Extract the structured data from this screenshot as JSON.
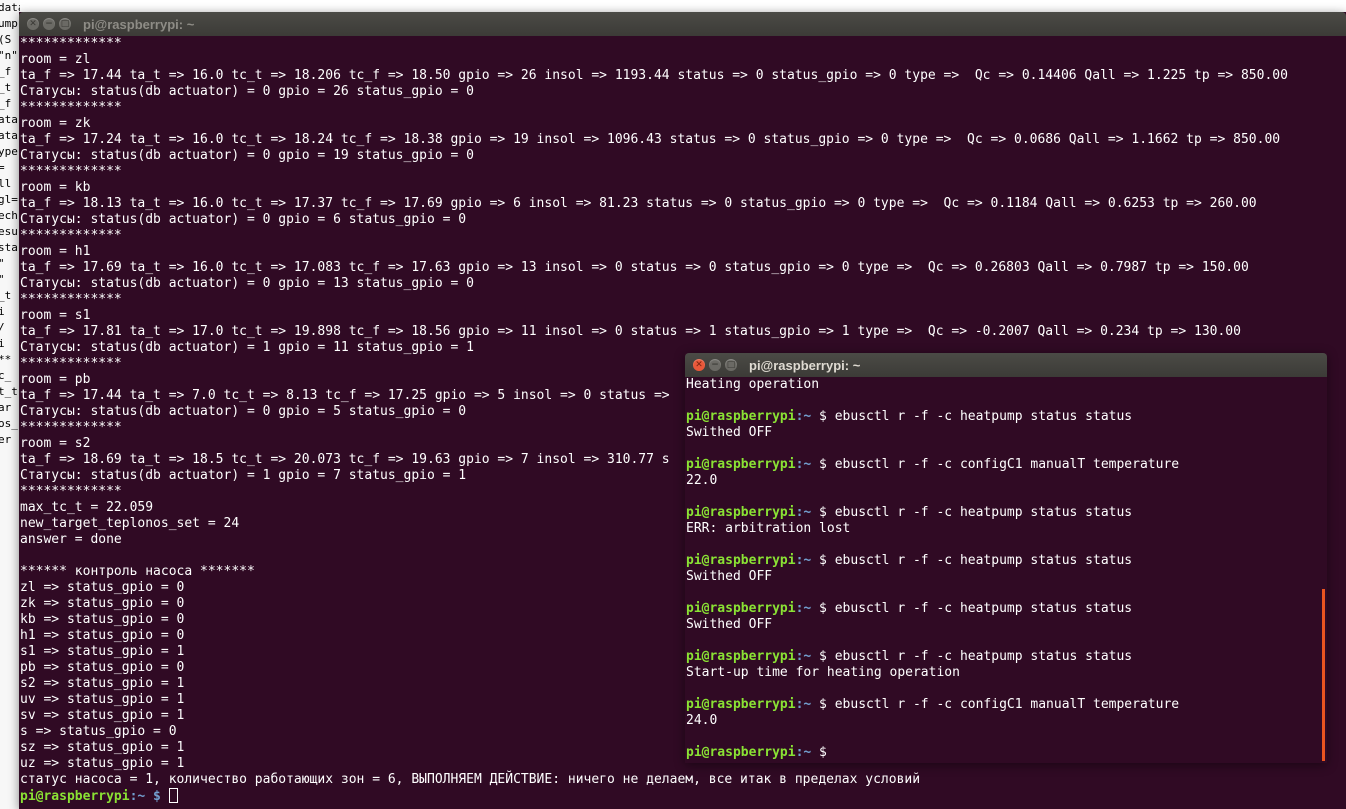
{
  "background_editor": {
    "lines": [
      "data",
      "ump",
      "(S",
      "",
      "\"n\"",
      "_f",
      "_t",
      "_f",
      "ata",
      "ata",
      "ype",
      "=",
      "ll",
      "",
      "gl=",
      "ech",
      "esu",
      "",
      "sta",
      "\"",
      "\"",
      "_t",
      "",
      "i",
      "",
      "",
      "",
      "",
      "",
      "",
      "",
      "/",
      "i",
      "",
      "",
      "",
      "",
      "",
      "",
      "",
      "",
      "",
      "",
      "**",
      "c_",
      "t_t",
      "ar",
      "",
      "os_",
      "er"
    ]
  },
  "main_window": {
    "title": "pi@raspberrypi: ~",
    "buttons": [
      "close",
      "minimize",
      "maximize"
    ],
    "lines": [
      "*************",
      "room = zl",
      "ta_f => 17.44 ta_t => 16.0 tc_t => 18.206 tc_f => 18.50 gpio => 26 insol => 1193.44 status => 0 status_gpio => 0 type =>  Qc => 0.14406 Qall => 1.225 tp => 850.00",
      "Статусы: status(db actuator) = 0 gpio = 26 status_gpio = 0",
      "*************",
      "room = zk",
      "ta_f => 17.24 ta_t => 16.0 tc_t => 18.24 tc_f => 18.38 gpio => 19 insol => 1096.43 status => 0 status_gpio => 0 type =>  Qc => 0.0686 Qall => 1.1662 tp => 850.00",
      "Статусы: status(db actuator) = 0 gpio = 19 status_gpio = 0",
      "*************",
      "room = kb",
      "ta_f => 18.13 ta_t => 16.0 tc_t => 17.37 tc_f => 17.69 gpio => 6 insol => 81.23 status => 0 status_gpio => 0 type =>  Qc => 0.1184 Qall => 0.6253 tp => 260.00",
      "Статусы: status(db actuator) = 0 gpio = 6 status_gpio = 0",
      "*************",
      "room = h1",
      "ta_f => 17.69 ta_t => 16.0 tc_t => 17.083 tc_f => 17.63 gpio => 13 insol => 0 status => 0 status_gpio => 0 type =>  Qc => 0.26803 Qall => 0.7987 tp => 150.00",
      "Статусы: status(db actuator) = 0 gpio = 13 status_gpio = 0",
      "*************",
      "room = s1",
      "ta_f => 17.81 ta_t => 17.0 tc_t => 19.898 tc_f => 18.56 gpio => 11 insol => 0 status => 1 status_gpio => 1 type =>  Qc => -0.2007 Qall => 0.234 tp => 130.00",
      "Статусы: status(db actuator) = 1 gpio = 11 status_gpio = 1",
      "*************",
      "room = pb",
      "ta_f => 17.44 ta_t => 7.0 tc_t => 8.13 tc_f => 17.25 gpio => 5 insol => 0 status =>",
      "Статусы: status(db actuator) = 0 gpio = 5 status_gpio = 0",
      "*************",
      "room = s2",
      "ta_f => 18.69 ta_t => 18.5 tc_t => 20.073 tc_f => 19.63 gpio => 7 insol => 310.77 s",
      "Статусы: status(db actuator) = 1 gpio = 7 status_gpio = 1",
      "*************",
      "max_tc_t = 22.059",
      "new_target_teplonos_set = 24",
      "answer = done",
      "",
      "****** контроль насоса *******",
      "zl => status_gpio = 0",
      "zk => status_gpio = 0",
      "kb => status_gpio = 0",
      "h1 => status_gpio = 0",
      "s1 => status_gpio = 1",
      "pb => status_gpio = 0",
      "s2 => status_gpio = 1",
      "uv => status_gpio = 1",
      "sv => status_gpio = 1",
      "s => status_gpio = 0",
      "sz => status_gpio = 1",
      "uz => status_gpio = 1",
      "статус насоса = 1, количество работающих зон = 6, ВЫПОЛНЯЕМ ДЕЙСТВИЕ: ничего не делаем, все итак в пределах условий"
    ],
    "final_prompt": {
      "user": "pi@raspberrypi",
      "path": ":~",
      "symbol": " $ "
    }
  },
  "overlay_window": {
    "title": "pi@raspberrypi: ~",
    "buttons": [
      "close",
      "minimize",
      "maximize"
    ],
    "lines": [
      {
        "type": "out",
        "text": "Heating operation"
      },
      {
        "type": "out",
        "text": ""
      },
      {
        "type": "cmd",
        "user": "pi@raspberrypi",
        "path": ":~",
        "symbol": " $ ",
        "text": "ebusctl r -f -c heatpump status status"
      },
      {
        "type": "out",
        "text": "Swithed OFF"
      },
      {
        "type": "out",
        "text": ""
      },
      {
        "type": "cmd",
        "user": "pi@raspberrypi",
        "path": ":~",
        "symbol": " $ ",
        "text": "ebusctl r -f -c configC1 manualT temperature"
      },
      {
        "type": "out",
        "text": "22.0"
      },
      {
        "type": "out",
        "text": ""
      },
      {
        "type": "cmd",
        "user": "pi@raspberrypi",
        "path": ":~",
        "symbol": " $ ",
        "text": "ebusctl r -f -c heatpump status status"
      },
      {
        "type": "out",
        "text": "ERR: arbitration lost"
      },
      {
        "type": "out",
        "text": ""
      },
      {
        "type": "cmd",
        "user": "pi@raspberrypi",
        "path": ":~",
        "symbol": " $ ",
        "text": "ebusctl r -f -c heatpump status status"
      },
      {
        "type": "out",
        "text": "Swithed OFF"
      },
      {
        "type": "out",
        "text": ""
      },
      {
        "type": "cmd",
        "user": "pi@raspberrypi",
        "path": ":~",
        "symbol": " $ ",
        "text": "ebusctl r -f -c heatpump status status"
      },
      {
        "type": "out",
        "text": "Swithed OFF"
      },
      {
        "type": "out",
        "text": ""
      },
      {
        "type": "cmd",
        "user": "pi@raspberrypi",
        "path": ":~",
        "symbol": " $ ",
        "text": "ebusctl r -f -c heatpump status status"
      },
      {
        "type": "out",
        "text": "Start-up time for heating operation"
      },
      {
        "type": "out",
        "text": ""
      },
      {
        "type": "cmd",
        "user": "pi@raspberrypi",
        "path": ":~",
        "symbol": " $ ",
        "text": "ebusctl r -f -c configC1 manualT temperature"
      },
      {
        "type": "out",
        "text": "24.0"
      },
      {
        "type": "out",
        "text": ""
      },
      {
        "type": "cmd",
        "user": "pi@raspberrypi",
        "path": ":~",
        "symbol": " $ ",
        "text": ""
      }
    ]
  },
  "colors": {
    "terminal_bg": "#300a24",
    "prompt_user": "#8ae234",
    "prompt_path": "#729fcf",
    "close_button": "#e9583a",
    "scrollbar": "#e95420"
  }
}
